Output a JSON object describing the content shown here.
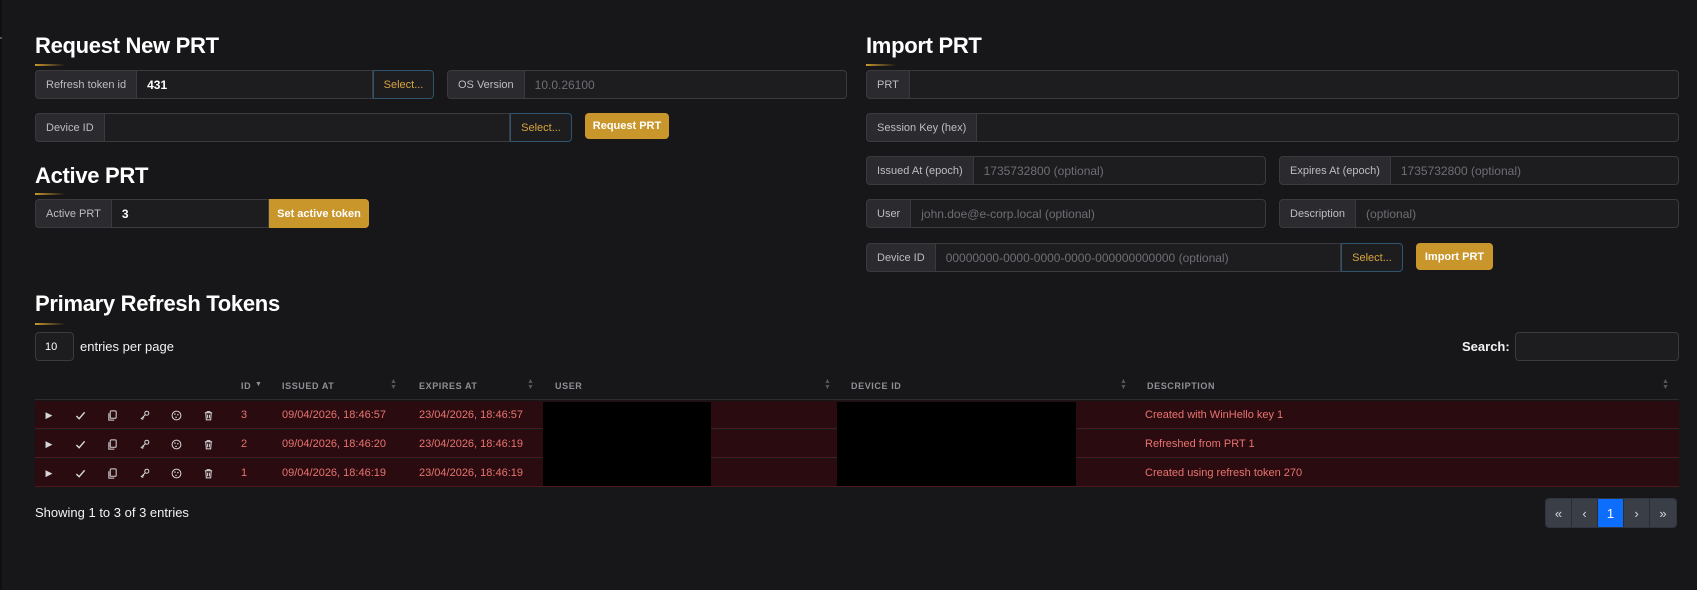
{
  "request_prt": {
    "title": "Request New PRT",
    "refresh_token_label": "Refresh token id",
    "refresh_token_value": "431",
    "select_label": "Select...",
    "os_version_label": "OS Version",
    "os_version_placeholder": "10.0.26100",
    "device_id_label": "Device ID",
    "device_id_value": "",
    "device_select_label": "Select...",
    "request_button": "Request PRT"
  },
  "active_prt": {
    "title": "Active PRT",
    "label": "Active PRT",
    "value": "3",
    "set_button": "Set active token"
  },
  "import_prt": {
    "title": "Import PRT",
    "prt_label": "PRT",
    "session_key_label": "Session Key (hex)",
    "issued_at_label": "Issued At (epoch)",
    "issued_at_placeholder": "1735732800 (optional)",
    "expires_at_label": "Expires At (epoch)",
    "expires_at_placeholder": "1735732800 (optional)",
    "user_label": "User",
    "user_placeholder": "john.doe@e-corp.local (optional)",
    "description_label": "Description",
    "description_placeholder": "(optional)",
    "device_id_label": "Device ID",
    "device_id_placeholder": "00000000-0000-0000-0000-000000000000 (optional)",
    "device_select_label": "Select...",
    "import_button": "Import PRT"
  },
  "tokens_table": {
    "title": "Primary Refresh Tokens",
    "page_size": "10",
    "entries_label": "entries per page",
    "search_label": "Search:",
    "columns": {
      "id": "ID",
      "issued_at": "ISSUED AT",
      "expires_at": "EXPIRES AT",
      "user": "USER",
      "device_id": "DEVICE ID",
      "description": "DESCRIPTION"
    },
    "row_icons": [
      "play-icon",
      "check-icon",
      "copy-icon",
      "key-icon",
      "cookie-icon",
      "trash-icon"
    ],
    "rows": [
      {
        "id": "3",
        "issued_at": "09/04/2026, 18:46:57",
        "expires_at": "23/04/2026, 18:46:57",
        "description": "Created with WinHello key 1"
      },
      {
        "id": "2",
        "issued_at": "09/04/2026, 18:46:20",
        "expires_at": "23/04/2026, 18:46:19",
        "description": "Refreshed from PRT 1"
      },
      {
        "id": "1",
        "issued_at": "09/04/2026, 18:46:19",
        "expires_at": "23/04/2026, 18:46:19",
        "description": "Created using refresh token 270"
      }
    ],
    "showing_text": "Showing 1 to 3 of 3 entries",
    "pagination": {
      "first": "«",
      "prev": "‹",
      "current": "1",
      "next": "›",
      "last": "»"
    }
  },
  "colors": {
    "accent_gold": "#c9962b",
    "row_highlight": "#2a0c10",
    "row_text": "#e9736f",
    "pager_active": "#0d6efd"
  }
}
